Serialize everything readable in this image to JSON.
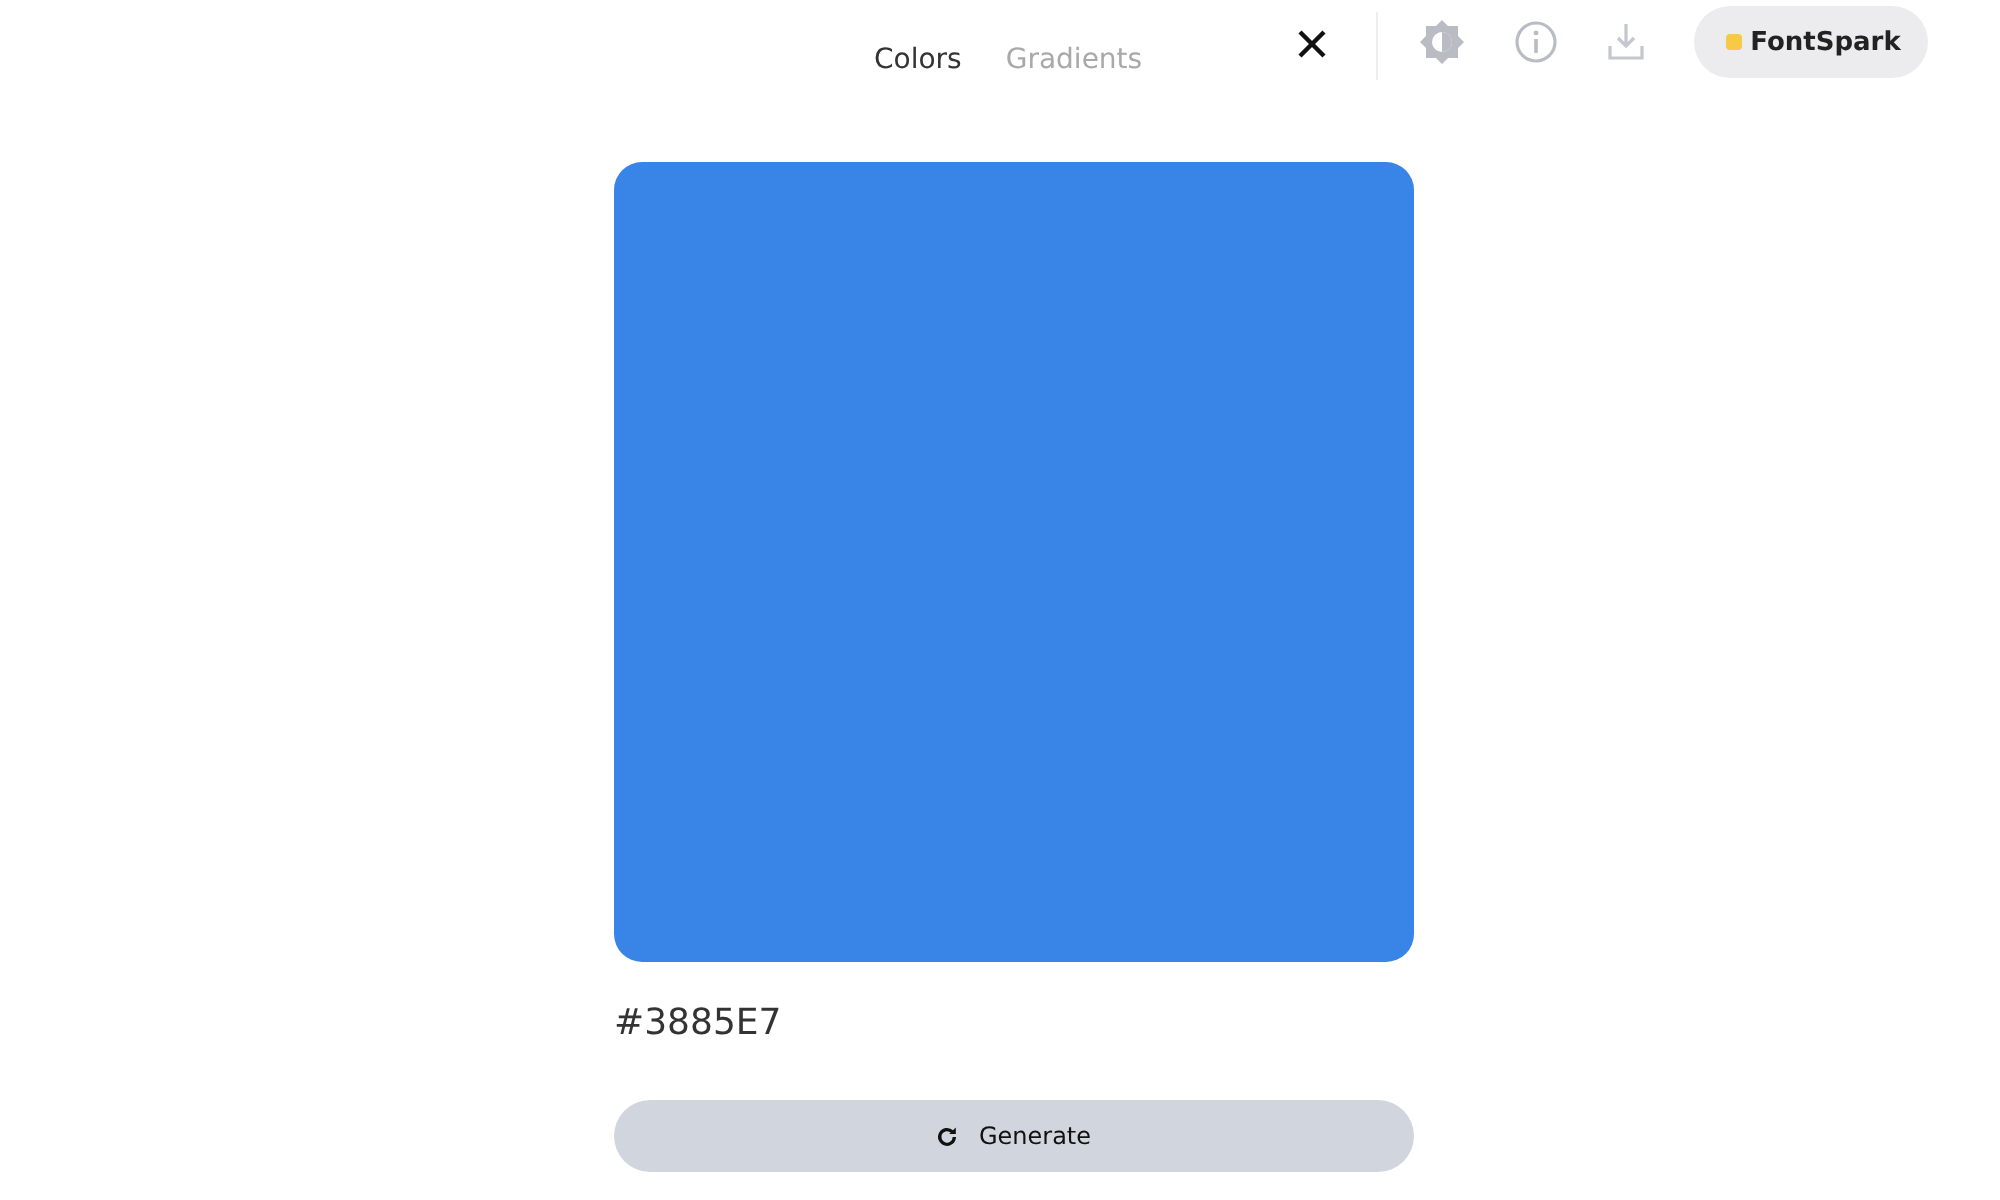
{
  "tabs": [
    {
      "label": "Colors",
      "selected": true
    },
    {
      "label": "Gradients",
      "selected": false
    }
  ],
  "brand": {
    "label": "FontSpark",
    "color": "#f7c948"
  },
  "swatch": {
    "color": "#3885e7",
    "hex": "#3885E7"
  },
  "generate_button": {
    "label": "Generate"
  }
}
